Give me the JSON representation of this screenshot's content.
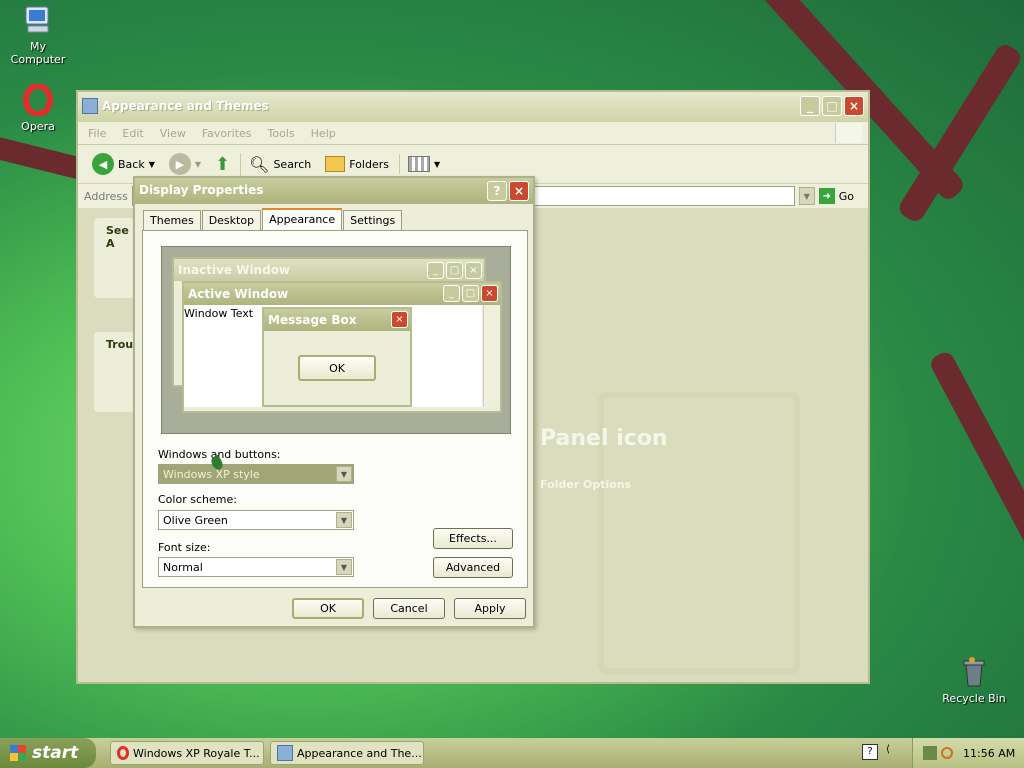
{
  "desktop": {
    "icons": [
      {
        "label": "My Computer",
        "icon": "computer-icon"
      },
      {
        "label": "Opera",
        "icon": "opera-icon"
      },
      {
        "label": "Recycle Bin",
        "icon": "recycle-bin-icon"
      }
    ]
  },
  "explorer": {
    "title": "Appearance and Themes",
    "menu": [
      "File",
      "Edit",
      "View",
      "Favorites",
      "Tools",
      "Help"
    ],
    "toolbar": {
      "back": "Back",
      "search": "Search",
      "folders": "Folders"
    },
    "address_label": "Address",
    "go": "Go",
    "see_also": "See A",
    "troubleshooters": "Troul",
    "content_heading": "Panel icon",
    "content_link": "Folder Options"
  },
  "dialog": {
    "title": "Display Properties",
    "tabs": [
      "Themes",
      "Desktop",
      "Appearance",
      "Settings"
    ],
    "active_tab": "Appearance",
    "preview": {
      "inactive_title": "Inactive Window",
      "active_title": "Active Window",
      "window_text": "Window Text",
      "message_box_title": "Message Box",
      "ok": "OK"
    },
    "windows_buttons_label": "Windows and buttons:",
    "windows_buttons_value": "Windows XP style",
    "color_scheme_label": "Color scheme:",
    "color_scheme_value": "Olive Green",
    "font_size_label": "Font size:",
    "font_size_value": "Normal",
    "effects": "Effects...",
    "advanced": "Advanced",
    "ok": "OK",
    "cancel": "Cancel",
    "apply": "Apply"
  },
  "taskbar": {
    "start": "start",
    "tasks": [
      "Windows XP Royale T...",
      "Appearance and The..."
    ],
    "clock": "11:56 AM"
  }
}
